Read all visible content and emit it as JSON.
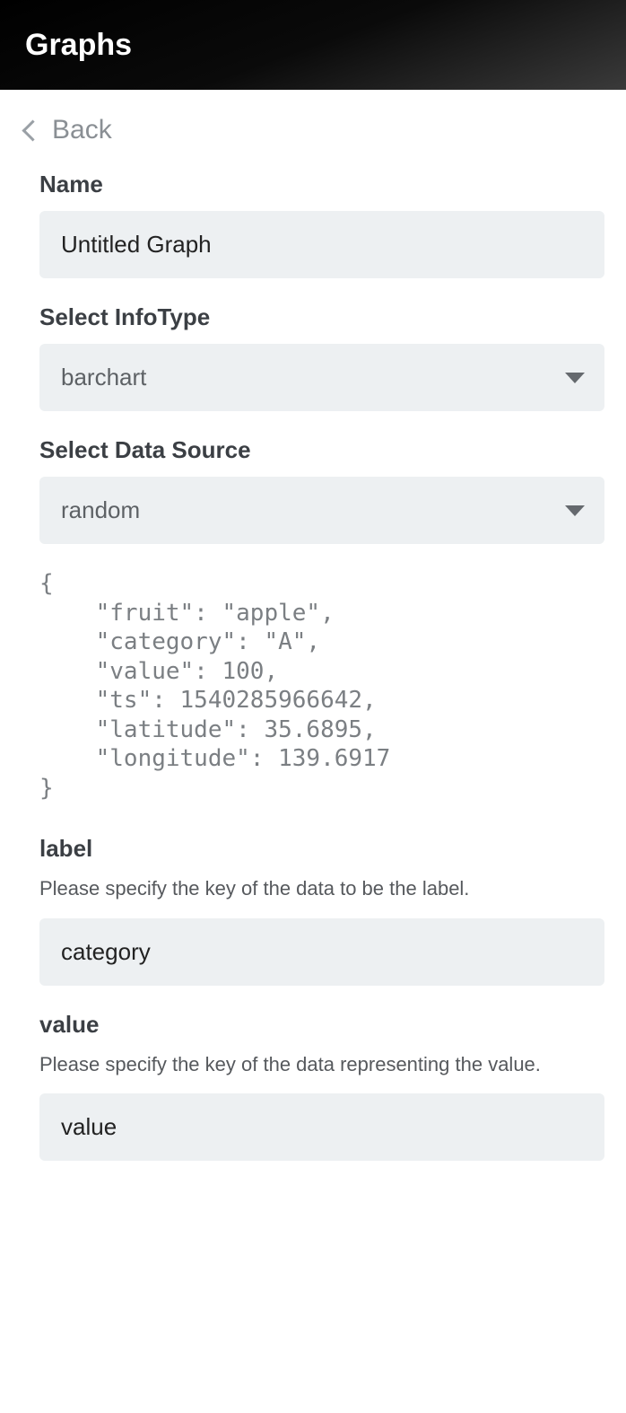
{
  "header": {
    "title": "Graphs"
  },
  "nav": {
    "back_label": "Back"
  },
  "form": {
    "name": {
      "label": "Name",
      "value": "Untitled Graph"
    },
    "infotype": {
      "label": "Select InfoType",
      "selected": "barchart"
    },
    "datasource": {
      "label": "Select Data Source",
      "selected": "random"
    },
    "preview": "{\n    \"fruit\": \"apple\",\n    \"category\": \"A\",\n    \"value\": 100,\n    \"ts\": 1540285966642,\n    \"latitude\": 35.6895,\n    \"longitude\": 139.6917\n}",
    "label_key": {
      "label": "label",
      "help": "Please specify the key of the data to be the label.",
      "value": "category"
    },
    "value_key": {
      "label": "value",
      "help": "Please specify the key of the data representing the value.",
      "value": "value"
    }
  }
}
